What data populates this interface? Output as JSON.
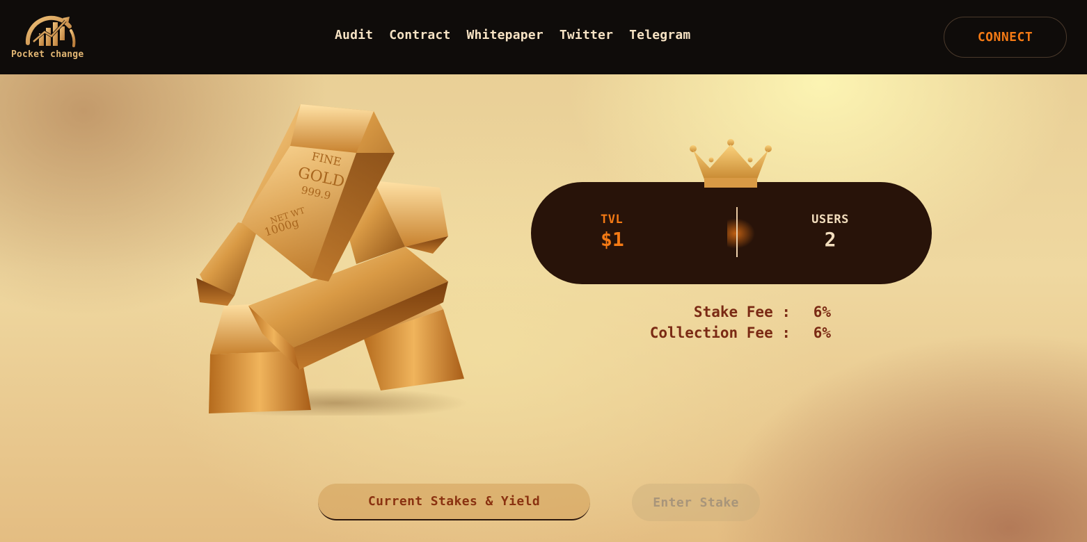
{
  "header": {
    "logo_text": "Pocket change",
    "nav": [
      "Audit",
      "Contract",
      "Whitepaper",
      "Twitter",
      "Telegram"
    ],
    "connect_label": "CONNECT"
  },
  "stats": {
    "tvl_label": "TVL",
    "tvl_value": "$1",
    "users_label": "USERS",
    "users_value": "2"
  },
  "fees": {
    "stake_label": "Stake Fee :",
    "stake_value": "6%",
    "collection_label": "Collection Fee :",
    "collection_value": "6%"
  },
  "tabs": {
    "current": "Current Stakes & Yield",
    "enter": "Enter Stake"
  },
  "colors": {
    "header_bg": "#0f0c0a",
    "accent_orange": "#f47a15",
    "pill_bg": "#281309",
    "fee_text": "#7a2a14",
    "gold": "#e3b774"
  },
  "icons": {
    "logo": "chart-arch-logo-icon",
    "crown": "crown-icon",
    "hero": "gold-bars-image"
  }
}
